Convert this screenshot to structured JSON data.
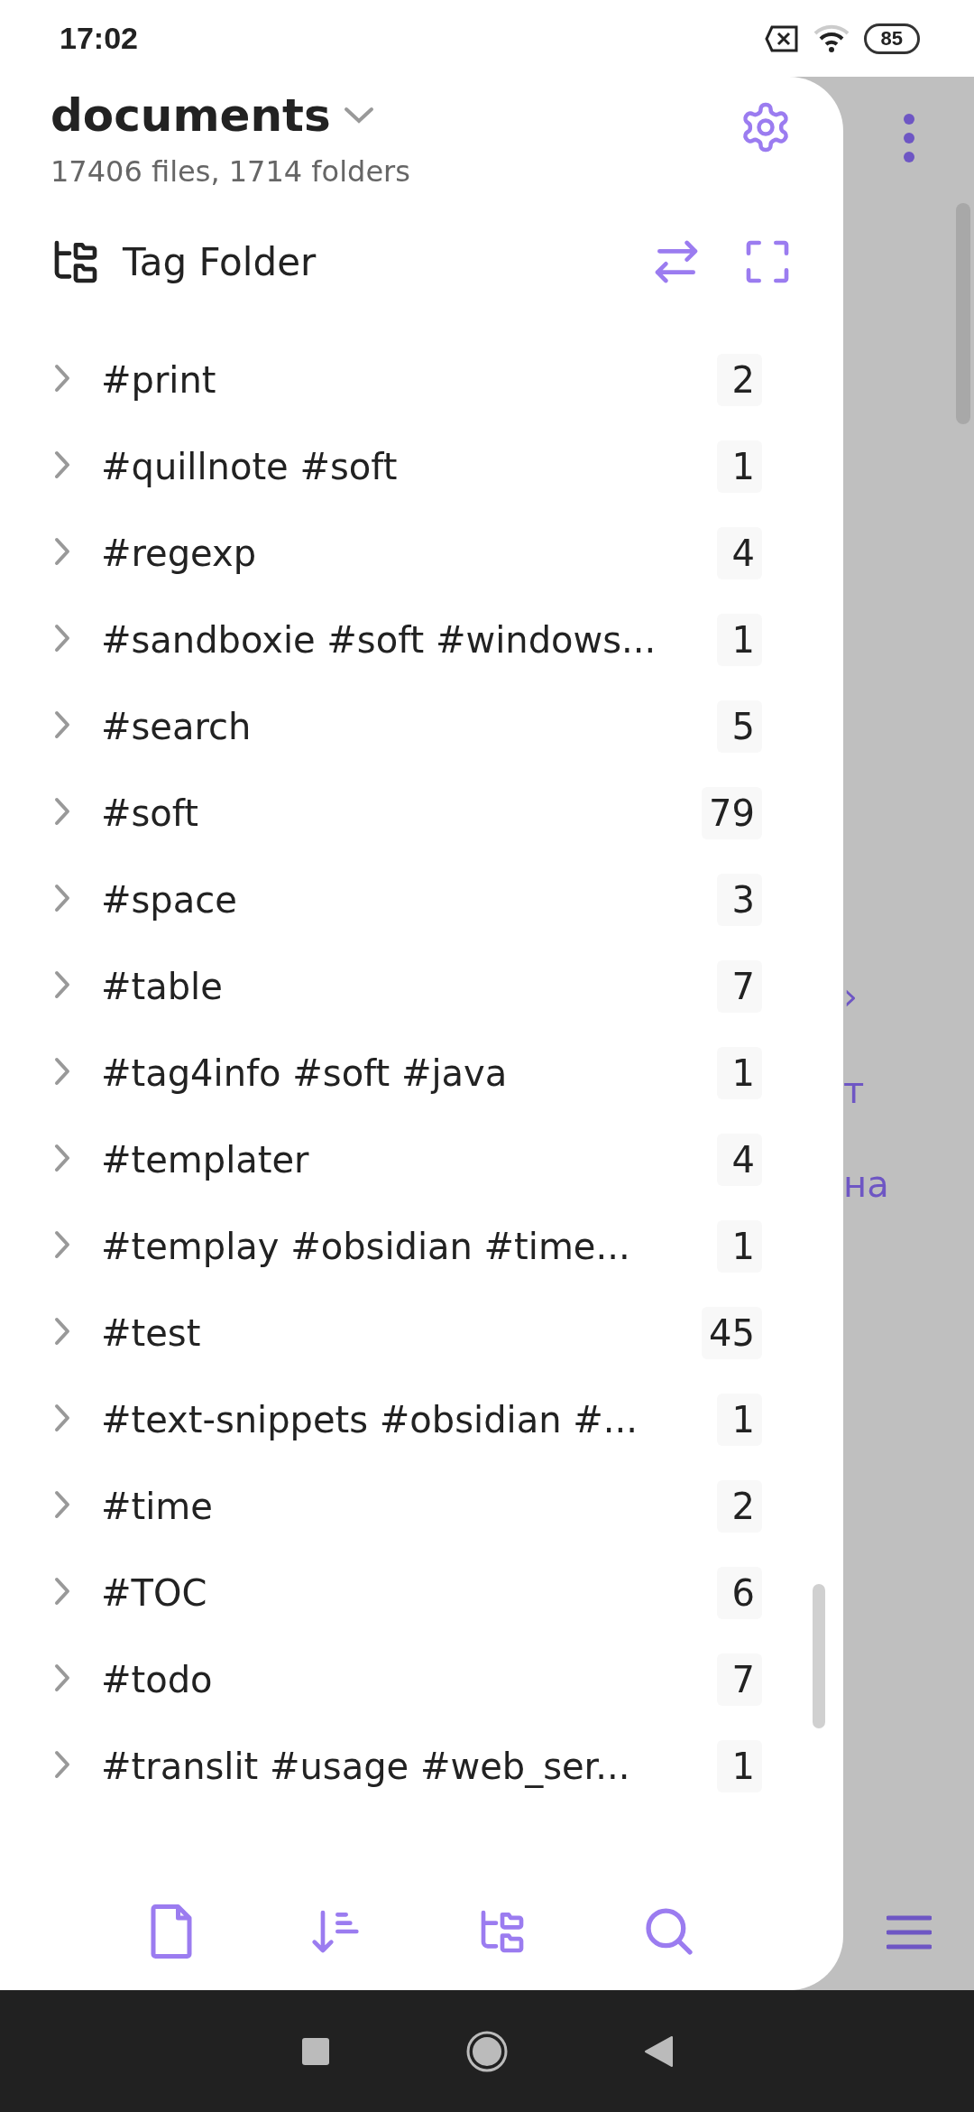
{
  "status_bar": {
    "time": "17:02",
    "battery": "85"
  },
  "vault": {
    "name": "documents",
    "stats": "17406 files, 1714 folders"
  },
  "panel": {
    "title": "Tag Folder"
  },
  "tags": [
    {
      "label": "#print",
      "count": "2",
      "expanded": false
    },
    {
      "label": "#quillnote #soft",
      "count": "1",
      "expanded": false
    },
    {
      "label": "#regexp",
      "count": "4",
      "expanded": false
    },
    {
      "label": "#sandboxie #soft #windows...",
      "count": "1",
      "expanded": false
    },
    {
      "label": "#search",
      "count": "5",
      "expanded": false
    },
    {
      "label": "#soft",
      "count": "79",
      "expanded": false
    },
    {
      "label": "#space",
      "count": "3",
      "expanded": false
    },
    {
      "label": "#table",
      "count": "7",
      "expanded": false
    },
    {
      "label": "#tag4info #soft #java",
      "count": "1",
      "expanded": false
    },
    {
      "label": "#templater",
      "count": "4",
      "expanded": false
    },
    {
      "label": "#templay #obsidian #time...",
      "count": "1",
      "expanded": false
    },
    {
      "label": "#test",
      "count": "45",
      "expanded": false
    },
    {
      "label": "#text-snippets #obsidian #...",
      "count": "1",
      "expanded": false
    },
    {
      "label": "#time",
      "count": "2",
      "expanded": false
    },
    {
      "label": "#TOC",
      "count": "6",
      "expanded": false
    },
    {
      "label": "#todo",
      "count": "7",
      "expanded": false
    },
    {
      "label": "#translit #usage #web_ser...",
      "count": "1",
      "expanded": false
    }
  ],
  "background_fragments": [
    "›",
    "т",
    "на"
  ]
}
